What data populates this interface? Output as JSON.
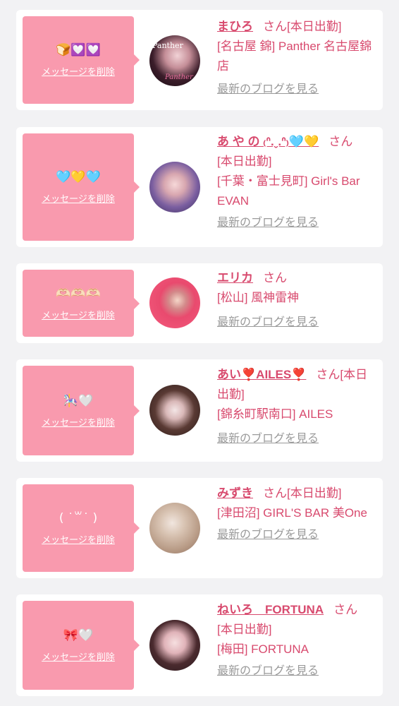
{
  "common": {
    "delete_label": "メッセージを削除",
    "blog_label": "最新のブログを見る",
    "san": "さん"
  },
  "cards": [
    {
      "emoji": "🍞💟💟",
      "name": "まひろ",
      "status": "[本日出勤]",
      "shop": "[名古屋 錦] Panther 名古屋錦店"
    },
    {
      "emoji": "🩵💛🩵",
      "name": "あ や の ₍ᐢ.ˬ.ᐢ₎🩵💛",
      "status": "[本日出勤]",
      "shop": "[千葉・富士見町] Girl's Bar EVAN"
    },
    {
      "emoji": "🫶🏻🫶🏻🫶🏻",
      "name": "エリカ",
      "status": "",
      "shop": "[松山] 風神雷神"
    },
    {
      "emoji": "🎠🤍",
      "name": "あい❣️AILES❣️",
      "status": "[本日出勤]",
      "shop": "[錦糸町駅南口] AILES"
    },
    {
      "emoji": "( ˙꒳˙ )",
      "name": "みずき",
      "status": "[本日出勤]",
      "shop": "[津田沼] GIRL'S BAR 美One"
    },
    {
      "emoji": "🎀🤍",
      "name": "ねいろ　FORTUNA",
      "status": "[本日出勤]",
      "shop": "[梅田] FORTUNA"
    }
  ]
}
